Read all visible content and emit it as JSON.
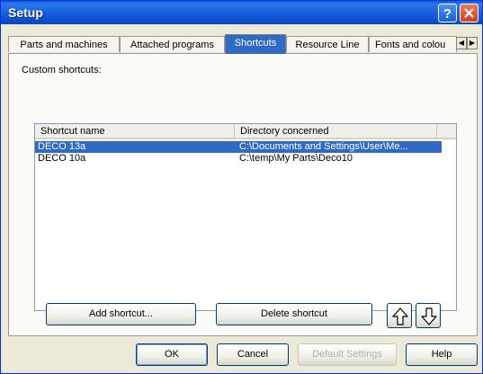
{
  "window": {
    "title": "Setup"
  },
  "tabs": [
    {
      "label": "Parts and machines",
      "selected": false
    },
    {
      "label": "Attached programs",
      "selected": false
    },
    {
      "label": "Shortcuts",
      "selected": true
    },
    {
      "label": "Resource Line",
      "selected": false
    },
    {
      "label": "Fonts and colou",
      "selected": false
    }
  ],
  "panel": {
    "group_label": "Custom shortcuts:",
    "columns": [
      "Shortcut name",
      "Directory concerned"
    ],
    "rows": [
      {
        "name": "DECO 13a",
        "directory": "C:\\Documents and Settings\\User\\Me...",
        "selected": true
      },
      {
        "name": "DECO 10a",
        "directory": "C:\\temp\\My Parts\\Deco10",
        "selected": false
      }
    ],
    "add_label": "Add shortcut...",
    "delete_label": "Delete shortcut"
  },
  "footer": {
    "ok_label": "OK",
    "cancel_label": "Cancel",
    "default_label": "Default Settings",
    "help_label": "Help"
  },
  "icons": [
    "help-icon",
    "close-icon",
    "tab-scroll-left-icon",
    "tab-scroll-right-icon",
    "arrow-up-icon",
    "arrow-down-icon"
  ],
  "colors": {
    "selection": "#316ac5",
    "titlebar": "#0a5ad6",
    "dialog": "#ece9d8"
  }
}
